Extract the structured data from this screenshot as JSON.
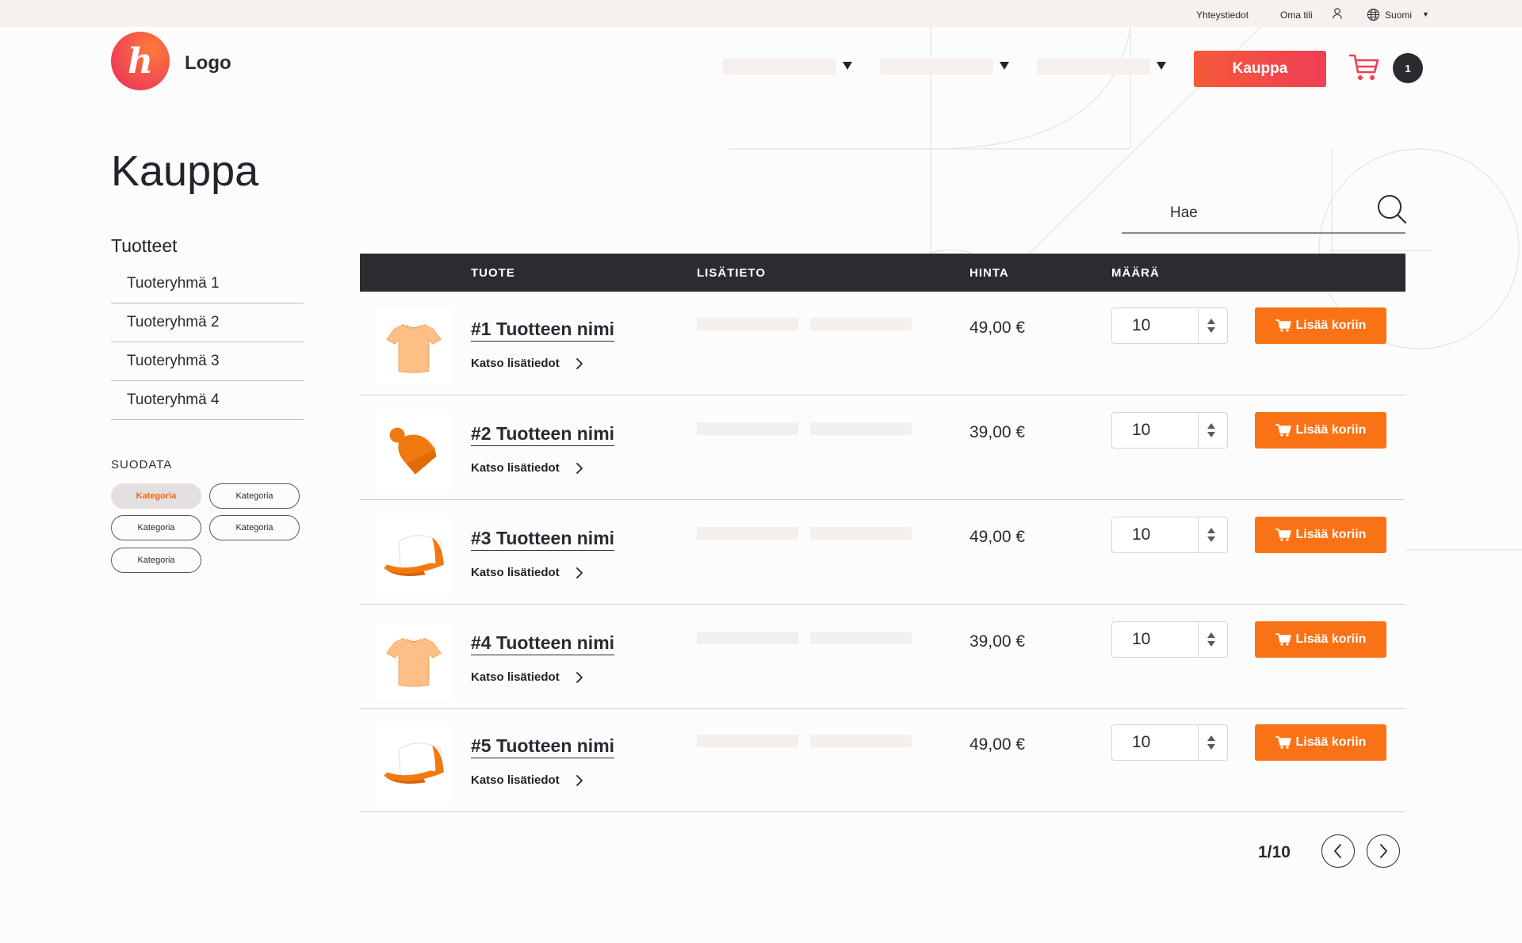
{
  "topbar": {
    "contact": "Yhteystiedot",
    "account": "Oma tili",
    "language": "Suomi",
    "icons": [
      "user-icon",
      "globe-icon",
      "caret-down-icon"
    ]
  },
  "header": {
    "logo_letter": "h",
    "logo_text": "Logo",
    "shop_button": "Kauppa",
    "cart_count": "1",
    "accent_color": "#ef3f55"
  },
  "page": {
    "title": "Kauppa"
  },
  "sidebar": {
    "heading": "Tuotteet",
    "categories": [
      "Tuoteryhmä 1",
      "Tuoteryhmä 2",
      "Tuoteryhmä 3",
      "Tuoteryhmä 4"
    ],
    "filter_heading": "SUODATA",
    "chips": [
      {
        "label": "Kategoria",
        "active": true
      },
      {
        "label": "Kategoria",
        "active": false
      },
      {
        "label": "Kategoria",
        "active": false
      },
      {
        "label": "Kategoria",
        "active": false
      },
      {
        "label": "Kategoria",
        "active": false
      }
    ]
  },
  "search": {
    "placeholder": "Hae"
  },
  "table": {
    "headers": {
      "product": "TUOTE",
      "info": "LISÄTIETO",
      "price": "HINTA",
      "quantity": "MÄÄRÄ"
    },
    "rows": [
      {
        "name": "#1 Tuotteen nimi",
        "more": "Katso lisätiedot",
        "price": "49,00 €",
        "quantity": "10",
        "add": "Lisää koriin",
        "image": "tshirt-icon"
      },
      {
        "name": "#2 Tuotteen nimi",
        "more": "Katso lisätiedot",
        "price": "39,00 €",
        "quantity": "10",
        "add": "Lisää koriin",
        "image": "beanie-icon"
      },
      {
        "name": "#3 Tuotteen nimi",
        "more": "Katso lisätiedot",
        "price": "49,00 €",
        "quantity": "10",
        "add": "Lisää koriin",
        "image": "cap-icon"
      },
      {
        "name": "#4 Tuotteen nimi",
        "more": "Katso lisätiedot",
        "price": "39,00 €",
        "quantity": "10",
        "add": "Lisää koriin",
        "image": "tshirt-icon"
      },
      {
        "name": "#5 Tuotteen nimi",
        "more": "Katso lisätiedot",
        "price": "49,00 €",
        "quantity": "10",
        "add": "Lisää koriin",
        "image": "cap-icon"
      }
    ],
    "button_color": "#f97316"
  },
  "pagination": {
    "current": "1/10"
  }
}
